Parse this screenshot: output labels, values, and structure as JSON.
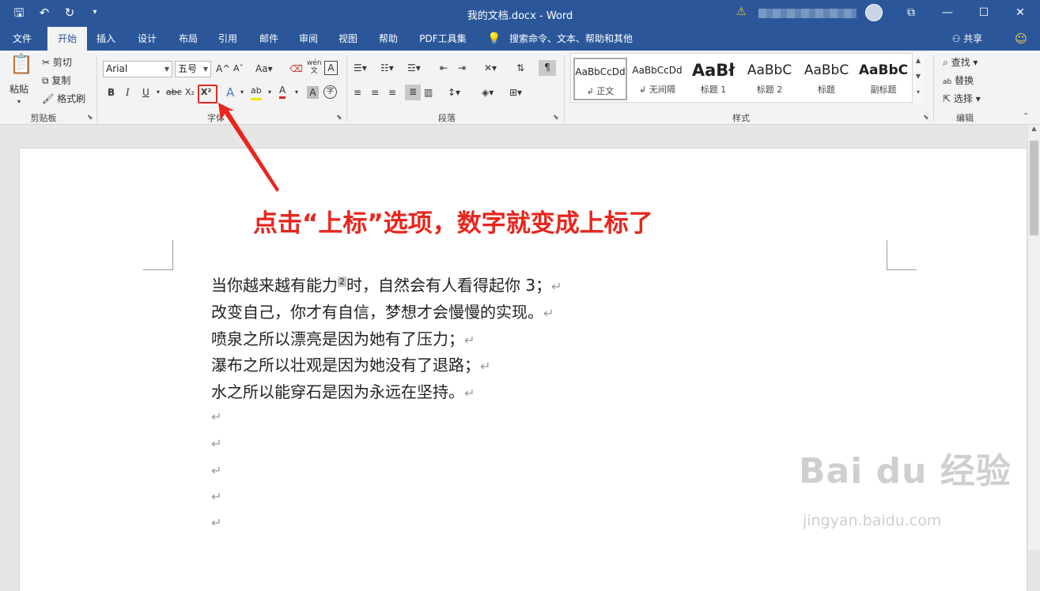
{
  "window": {
    "title": "我的文档.docx  -  Word"
  },
  "quick_access": {
    "save_icon": "save-icon",
    "undo_icon": "undo-icon",
    "redo_icon": "redo-icon",
    "customize_icon": "customize-qat-icon"
  },
  "tabs": [
    {
      "label": "文件"
    },
    {
      "label": "开始"
    },
    {
      "label": "插入"
    },
    {
      "label": "设计"
    },
    {
      "label": "布局"
    },
    {
      "label": "引用"
    },
    {
      "label": "邮件"
    },
    {
      "label": "审阅"
    },
    {
      "label": "视图"
    },
    {
      "label": "帮助"
    },
    {
      "label": "PDF工具集"
    }
  ],
  "tell_me": {
    "placeholder": "搜索命令、文本、帮助和其他"
  },
  "share": {
    "label": "共享"
  },
  "ribbon": {
    "clipboard": {
      "group": "剪贴板",
      "paste": "粘贴",
      "cut": "剪切",
      "copy": "复制",
      "format_painter": "格式刷"
    },
    "font": {
      "group": "字体",
      "font_name": "Arial",
      "font_size": "五号",
      "bold": "B",
      "italic": "I",
      "underline": "U",
      "strike": "abc",
      "subscript": "X₂",
      "superscript": "X²",
      "grow": "A",
      "shrink": "A",
      "change_case": "Aa",
      "phonetic": "wén",
      "clear": "A",
      "text_effects": "A",
      "font_color": "A",
      "char_shading": "A",
      "enclose": "字",
      "highlight": "ab"
    },
    "paragraph": {
      "group": "段落"
    },
    "styles": {
      "group": "样式",
      "items": [
        {
          "preview": "AaBbCcDd",
          "name": "↲ 正文"
        },
        {
          "preview": "AaBbCcDd",
          "name": "↲ 无间隔"
        },
        {
          "preview": "AaBł",
          "name": "标题 1"
        },
        {
          "preview": "AaBbC",
          "name": "标题 2"
        },
        {
          "preview": "AaBbC",
          "name": "标题"
        },
        {
          "preview": "AaBbC",
          "name": "副标题"
        }
      ]
    },
    "editing": {
      "group": "编辑",
      "find": "查找",
      "replace": "替换",
      "select": "选择"
    }
  },
  "annotation": "点击“上标”选项，数字就变成上标了",
  "document": {
    "line1_before": "当你越来越有能力",
    "line1_sup": "2",
    "line1_after": "时，自然会有人看得起你 3；",
    "lines": [
      "改变自己，你才有自信，梦想才会慢慢的实现。",
      "喷泉之所以漂亮是因为她有了压力；",
      "瀑布之所以壮观是因为她没有了退路；",
      "水之所以能穿石是因为永远在坚持。"
    ],
    "paragraph_mark": "↵"
  },
  "watermark": {
    "brand": "Bai du 经验",
    "url": "jingyan.baidu.com"
  },
  "colors": {
    "titlebar": "#2b579a",
    "annotation": "#e8261d",
    "highlight_box": "#e52a2a"
  }
}
